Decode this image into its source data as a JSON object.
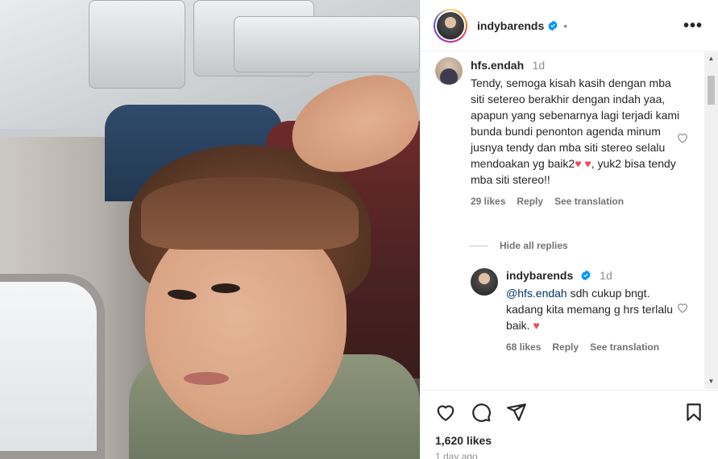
{
  "post": {
    "author": "indybarends",
    "header_dot": "•",
    "more": "•••",
    "likes": "1,620 likes",
    "date": "1 day ago"
  },
  "comments": [
    {
      "user": "hfs.endah",
      "time": "1d",
      "text": "Tendy, semoga kisah kasih dengan mba siti setereo berakhir dengan indah yaa, apapun yang sebenarnya lagi terjadi kami bunda bundi penonton agenda minum jusnya tendy dan mba siti stereo selalu mendoakan yg baik2",
      "text_after": ", yuk2 bisa tendy mba siti stereo!!",
      "likes": "29 likes",
      "reply": "Reply",
      "translate": "See translation"
    }
  ],
  "hide_replies": "Hide all replies",
  "reply": {
    "user": "indybarends",
    "time": "1d",
    "mention": "@hfs.endah",
    "text": " sdh cukup bngt. kadang kita memang g hrs terlalu baik.",
    "likes": "68 likes",
    "reply": "Reply",
    "translate": "See translation"
  },
  "icons": {
    "heart": "♥",
    "scroll_up": "▲",
    "scroll_down": "▼"
  },
  "colors": {
    "verified": "#0095f6",
    "heart_red": "#ed4956",
    "mention": "#00376b"
  }
}
